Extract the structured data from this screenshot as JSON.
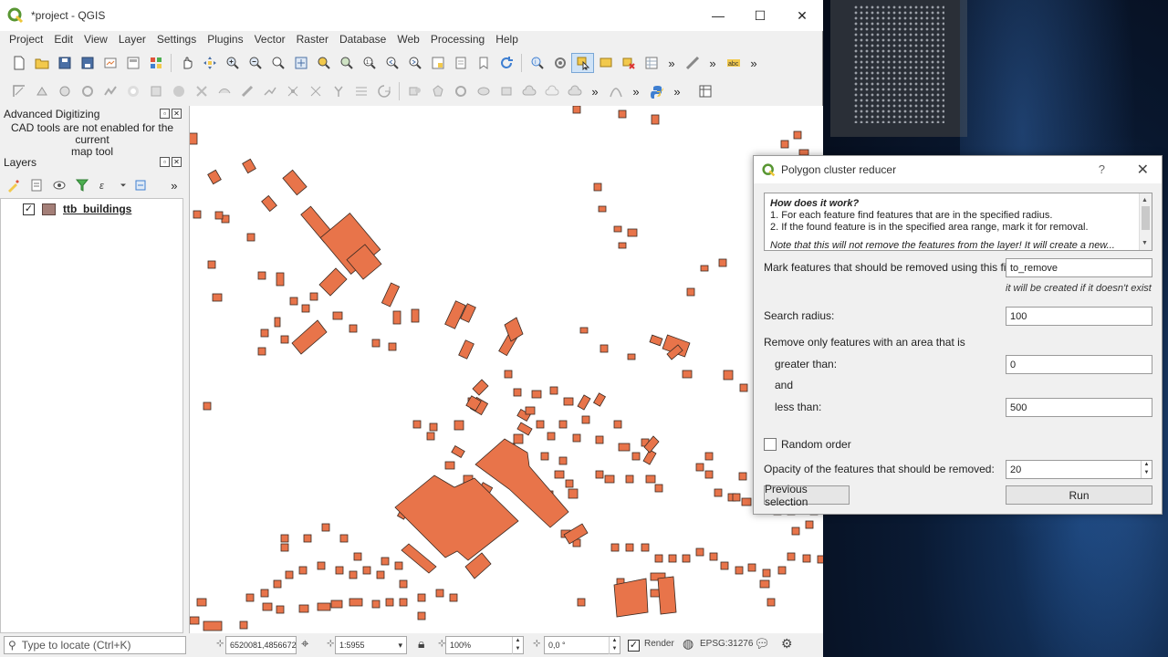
{
  "window": {
    "title": "*project - QGIS",
    "minimize": "—",
    "maximize": "☐",
    "close": "✕"
  },
  "menu": [
    "Project",
    "Edit",
    "View",
    "Layer",
    "Settings",
    "Plugins",
    "Vector",
    "Raster",
    "Database",
    "Web",
    "Processing",
    "Help"
  ],
  "panels": {
    "digitizing": {
      "title": "Advanced Digitizing",
      "message_line1": "CAD tools are not enabled for the current",
      "message_line2": "map tool"
    },
    "layers": {
      "title": "Layers",
      "items": [
        {
          "name": "ttb_buildings",
          "checked": "✓"
        }
      ]
    }
  },
  "toolbar_more": "»",
  "statusbar": {
    "locate_placeholder": "Type to locate (Ctrl+K)",
    "coordinate": "6520081,4856672",
    "scale": "1:5955",
    "magnifier": "100%",
    "rotation": "0,0 °",
    "render_label": "Render",
    "render_checked": "✓",
    "crs": "EPSG:31276"
  },
  "dialog": {
    "title": "Polygon cluster reducer",
    "help": "?",
    "close": "✕",
    "info": {
      "heading": "How does it work?",
      "line1": "1. For each feature find features that are in the specified radius.",
      "line2": "2. If the found feature is in the specified area range, mark it for removal.",
      "note": "Note that this will not remove the features from the layer! It will create a new..."
    },
    "field_label": "Mark features that should be removed using this field:",
    "field_value": "to_remove",
    "field_hint": "it will be created if it doesn't exist",
    "radius_label": "Search radius:",
    "radius_value": "100",
    "area_label": "Remove only features with an area that is",
    "greater_label": "greater than:",
    "greater_value": "0",
    "and_label": "and",
    "less_label": "less than:",
    "less_value": "500",
    "random_label": "Random order",
    "opacity_label": "Opacity of the features that should be removed:",
    "opacity_value": "20",
    "prev_button": "Previous selection",
    "run_button": "Run"
  },
  "colors": {
    "building_fill": "#e8744a",
    "building_stroke": "#3a2a22",
    "qgis_green": "#589632",
    "qgis_yellow": "#eec73a"
  }
}
